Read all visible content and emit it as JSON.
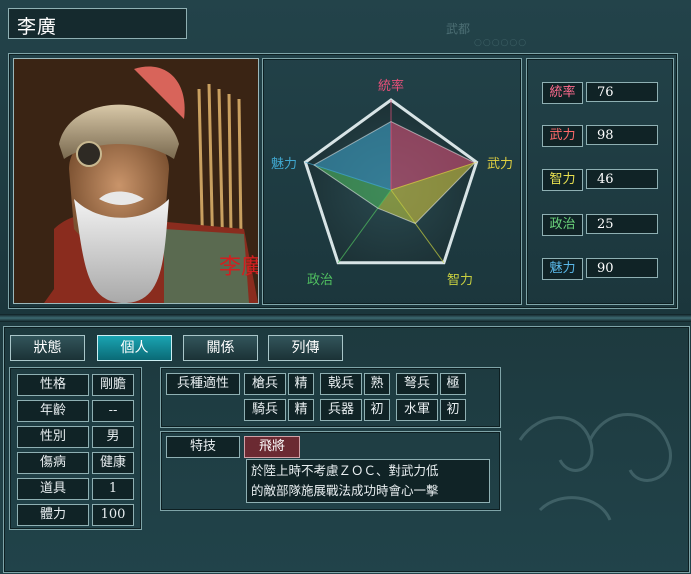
{
  "officer": {
    "name": "李廣",
    "portrait_seal": "李廣"
  },
  "header_ghost": {
    "tag": "武都",
    "dots": "○○○○○○"
  },
  "radar": {
    "axes": [
      "統率",
      "武力",
      "智力",
      "政治",
      "魅力"
    ],
    "axis_colors": [
      "#e8507a",
      "#e0d040",
      "#c8d040",
      "#50c060",
      "#40a8d0"
    ]
  },
  "stats": [
    {
      "label": "統率",
      "value": "76",
      "color": "#ff6b8e"
    },
    {
      "label": "武力",
      "value": "98",
      "color": "#ff6a6a"
    },
    {
      "label": "智力",
      "value": "46",
      "color": "#e8e050"
    },
    {
      "label": "政治",
      "value": "25",
      "color": "#6ad27a"
    },
    {
      "label": "魅力",
      "value": "90",
      "color": "#5ab8e8"
    }
  ],
  "tabs": [
    {
      "label": "狀態",
      "active": false
    },
    {
      "label": "個人",
      "active": true
    },
    {
      "label": "關係",
      "active": false
    },
    {
      "label": "列傳",
      "active": false
    }
  ],
  "personal": [
    {
      "label": "性格",
      "value": "剛膽"
    },
    {
      "label": "年齡",
      "value": "--"
    },
    {
      "label": "性別",
      "value": "男"
    },
    {
      "label": "傷病",
      "value": "健康"
    },
    {
      "label": "道具",
      "value": "1"
    },
    {
      "label": "體力",
      "value": "100"
    }
  ],
  "troops": {
    "title": "兵種適性",
    "rows": [
      [
        {
          "type": "槍兵",
          "grade": "精"
        },
        {
          "type": "戟兵",
          "grade": "熟"
        },
        {
          "type": "弩兵",
          "grade": "極"
        }
      ],
      [
        {
          "type": "騎兵",
          "grade": "精"
        },
        {
          "type": "兵器",
          "grade": "初"
        },
        {
          "type": "水軍",
          "grade": "初"
        }
      ]
    ]
  },
  "skill": {
    "title": "特技",
    "name": "飛將",
    "desc_line1": "於陸上時不考慮ＺＯＣ、對武力低",
    "desc_line2": "的敵部隊施展戰法成功時會心一擊"
  }
}
